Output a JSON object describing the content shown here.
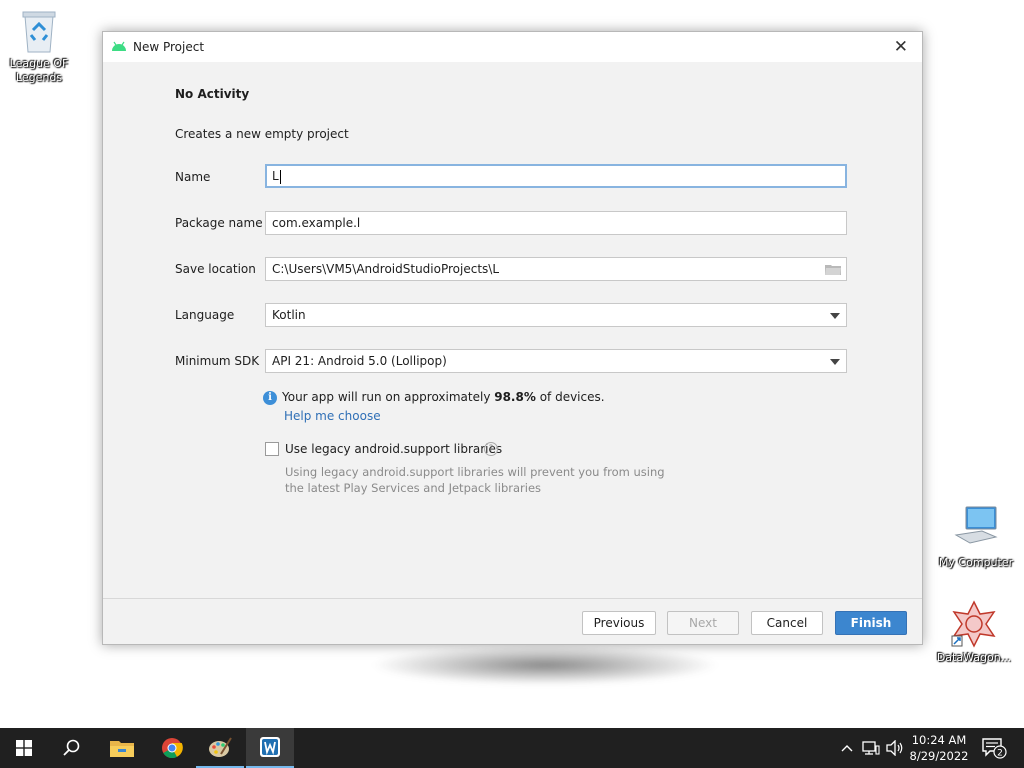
{
  "desktop": {
    "icons": [
      {
        "label": "League OF Legends"
      },
      {
        "label": "My Computer"
      },
      {
        "label": "DataWagon..."
      }
    ]
  },
  "dialog": {
    "title": "New Project",
    "heading": "No Activity",
    "subtitle": "Creates a new empty project",
    "fields": {
      "name": {
        "label": "Name",
        "value": "L"
      },
      "package": {
        "label": "Package name",
        "value": "com.example.l"
      },
      "location": {
        "label": "Save location",
        "value": "C:\\Users\\VM5\\AndroidStudioProjects\\L"
      },
      "language": {
        "label": "Language",
        "value": "Kotlin"
      },
      "sdk": {
        "label": "Minimum SDK",
        "value": "API 21: Android 5.0 (Lollipop)"
      }
    },
    "info": {
      "prefix": "Your app will run on approximately ",
      "percent": "98.8%",
      "suffix": " of devices.",
      "link": "Help me choose"
    },
    "legacy": {
      "label": "Use legacy android.support libraries",
      "checked": false,
      "hint_line1": "Using legacy android.support libraries will prevent you from using",
      "hint_line2": "the latest Play Services and Jetpack libraries"
    },
    "buttons": {
      "previous": "Previous",
      "next": "Next",
      "cancel": "Cancel",
      "finish": "Finish"
    }
  },
  "taskbar": {
    "time": "10:24 AM",
    "date": "8/29/2022",
    "notification_count": "2",
    "items": [
      "start-icon",
      "search-icon",
      "file-explorer-icon",
      "chrome-icon",
      "paint-icon",
      "android-studio-icon"
    ]
  },
  "colors": {
    "accent": "#3c86cf",
    "link": "#2f6fb6",
    "taskbar": "#202020"
  }
}
